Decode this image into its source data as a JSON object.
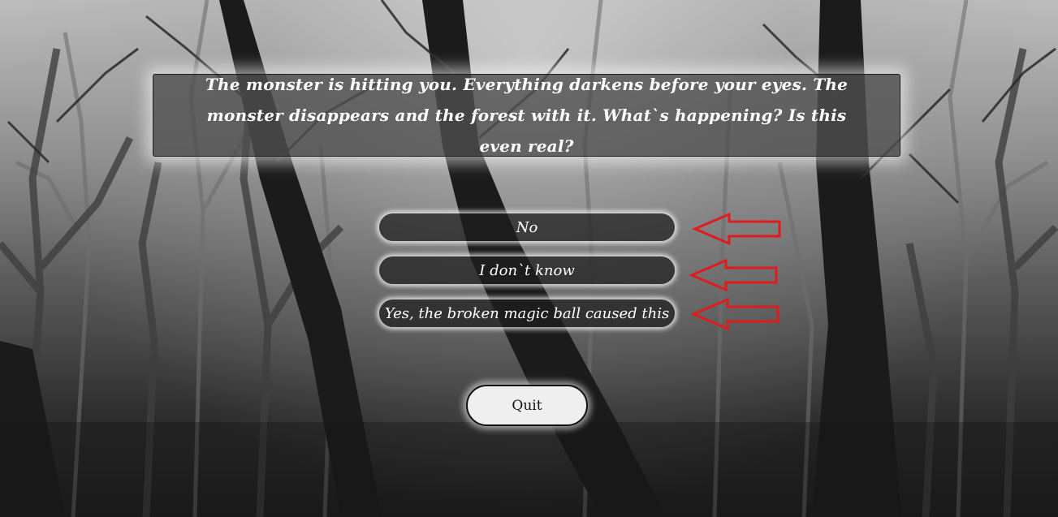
{
  "story": {
    "text": "The monster is hitting you. Everything darkens before your eyes. The monster disappears and the forest with it. What`s happening? Is this even real?"
  },
  "choices": [
    {
      "label": "No"
    },
    {
      "label": "I don`t know"
    },
    {
      "label": "Yes, the broken magic ball caused this"
    }
  ],
  "quit": {
    "label": "Quit"
  },
  "colors": {
    "arrow": "#e01b1b",
    "choice_bg": "#1e1e1e",
    "quit_bg": "#efefef"
  },
  "icons": {
    "choice_marker": "left-arrow-icon"
  }
}
